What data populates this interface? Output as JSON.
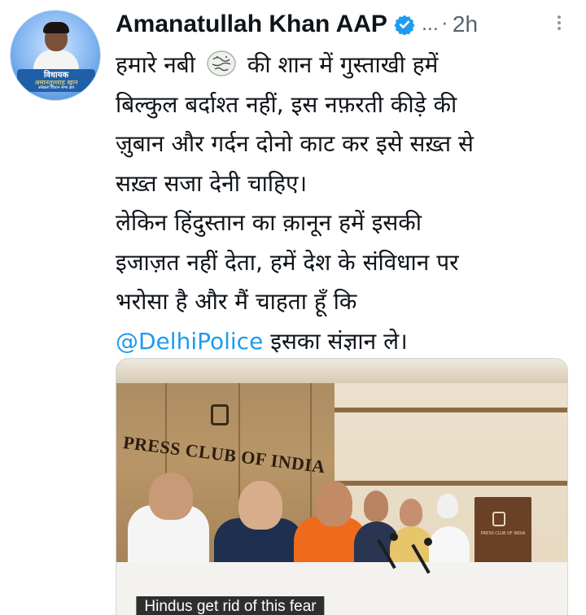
{
  "tweet": {
    "author": {
      "display_name": "Amanatullah Khan AAP",
      "handle": "...",
      "time": "2h",
      "separator": "·",
      "verified": true,
      "avatar_banner": {
        "line1": "विधायक",
        "line2": "अमानतुल्लाह खान",
        "line3": "ओखला विधान सभा क्षेत्र"
      }
    },
    "text_lines": [
      {
        "before": "हमारे नबी",
        "after": "की शान में गुस्ताखी हमें"
      },
      {
        "text": "बिल्कुल बर्दाश्त नहीं, इस नफ़रती कीड़े की"
      },
      {
        "text": "ज़ुबान और गर्दन दोनो काट कर इसे सख़्त से"
      },
      {
        "text": "सख़्त सजा देनी चाहिए।"
      },
      {
        "text": "लेकिन हिंदुस्तान का क़ानून हमें इसकी"
      },
      {
        "text": "इजाज़त नहीं देता, हमें देश के संविधान पर"
      },
      {
        "text": "भरोसा है और मैं चाहता हूँ कि"
      },
      {
        "mention": "@DelhiPolice",
        "after": " इसका संज्ञान ले।"
      }
    ],
    "media": {
      "backdrop_text": "PRESS CLUB OF INDIA",
      "podium_text": "PRESS CLUB OF INDIA",
      "caption": "Hindus get rid of this fear"
    }
  },
  "colors": {
    "link": "#1d9bf0",
    "verified_badge": "#1d9bf0",
    "secondary_text": "#536471",
    "primary_text": "#0f1419"
  },
  "icons": [
    "verified-badge-icon",
    "more-options-icon",
    "honorific-seal-icon",
    "press-club-logo-icon"
  ]
}
